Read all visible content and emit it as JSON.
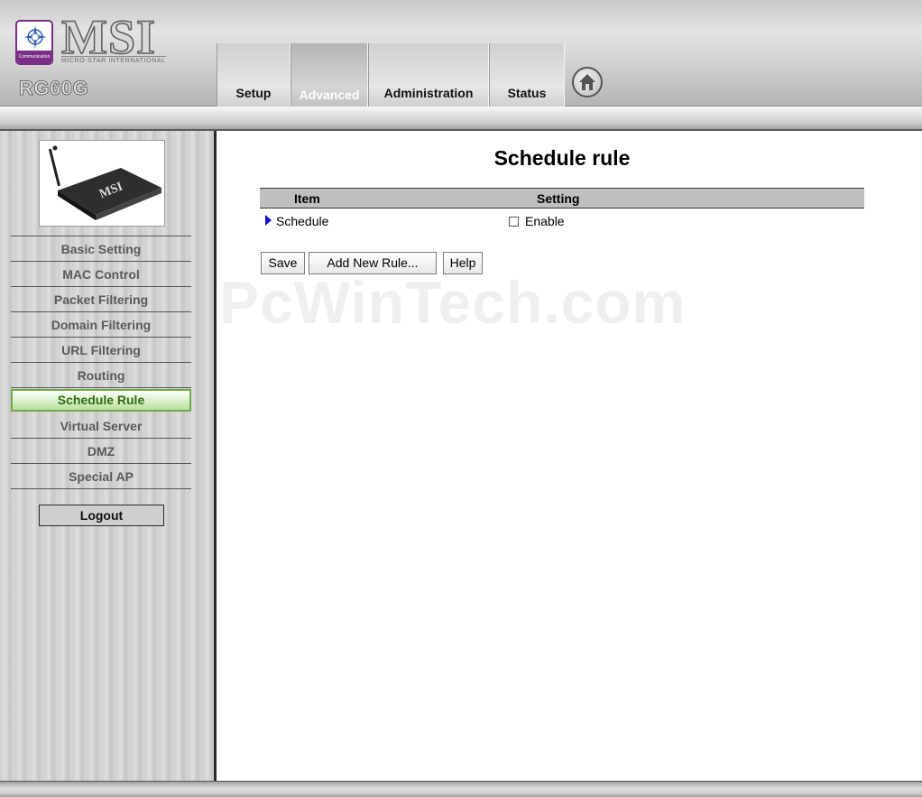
{
  "header": {
    "brand": "MSI",
    "brand_sub": "MICRO-STAR INTERNATIONAL",
    "logo_text": "Communication",
    "model": "RG60G",
    "tabs": [
      {
        "label": "Setup",
        "active": false
      },
      {
        "label": "Advanced",
        "active": true
      },
      {
        "label": "Administration",
        "active": false
      },
      {
        "label": "Status",
        "active": false
      }
    ],
    "home_icon": "home-icon"
  },
  "sidebar": {
    "items": [
      {
        "label": "Basic Setting",
        "active": false
      },
      {
        "label": "MAC Control",
        "active": false
      },
      {
        "label": "Packet Filtering",
        "active": false
      },
      {
        "label": "Domain Filtering",
        "active": false
      },
      {
        "label": "URL Filtering",
        "active": false
      },
      {
        "label": "Routing",
        "active": false
      },
      {
        "label": "Schedule Rule",
        "active": true
      },
      {
        "label": "Virtual Server",
        "active": false
      },
      {
        "label": "DMZ",
        "active": false
      },
      {
        "label": "Special AP",
        "active": false
      }
    ],
    "logout_label": "Logout",
    "product_label": "MSI"
  },
  "main": {
    "title": "Schedule rule",
    "table": {
      "headers": [
        "Item",
        "Setting"
      ],
      "rows": [
        {
          "item": "Schedule",
          "setting_label": "Enable",
          "checked": false
        }
      ]
    },
    "buttons": {
      "save": "Save",
      "add_rule": "Add New Rule...",
      "help": "Help"
    },
    "watermark": "PcWinTech.com"
  },
  "colors": {
    "active_nav_text": "#2d6b12",
    "active_nav_border": "#6faa4a",
    "arrow": "#1010d0",
    "logo_purple": "#7a2f86"
  }
}
